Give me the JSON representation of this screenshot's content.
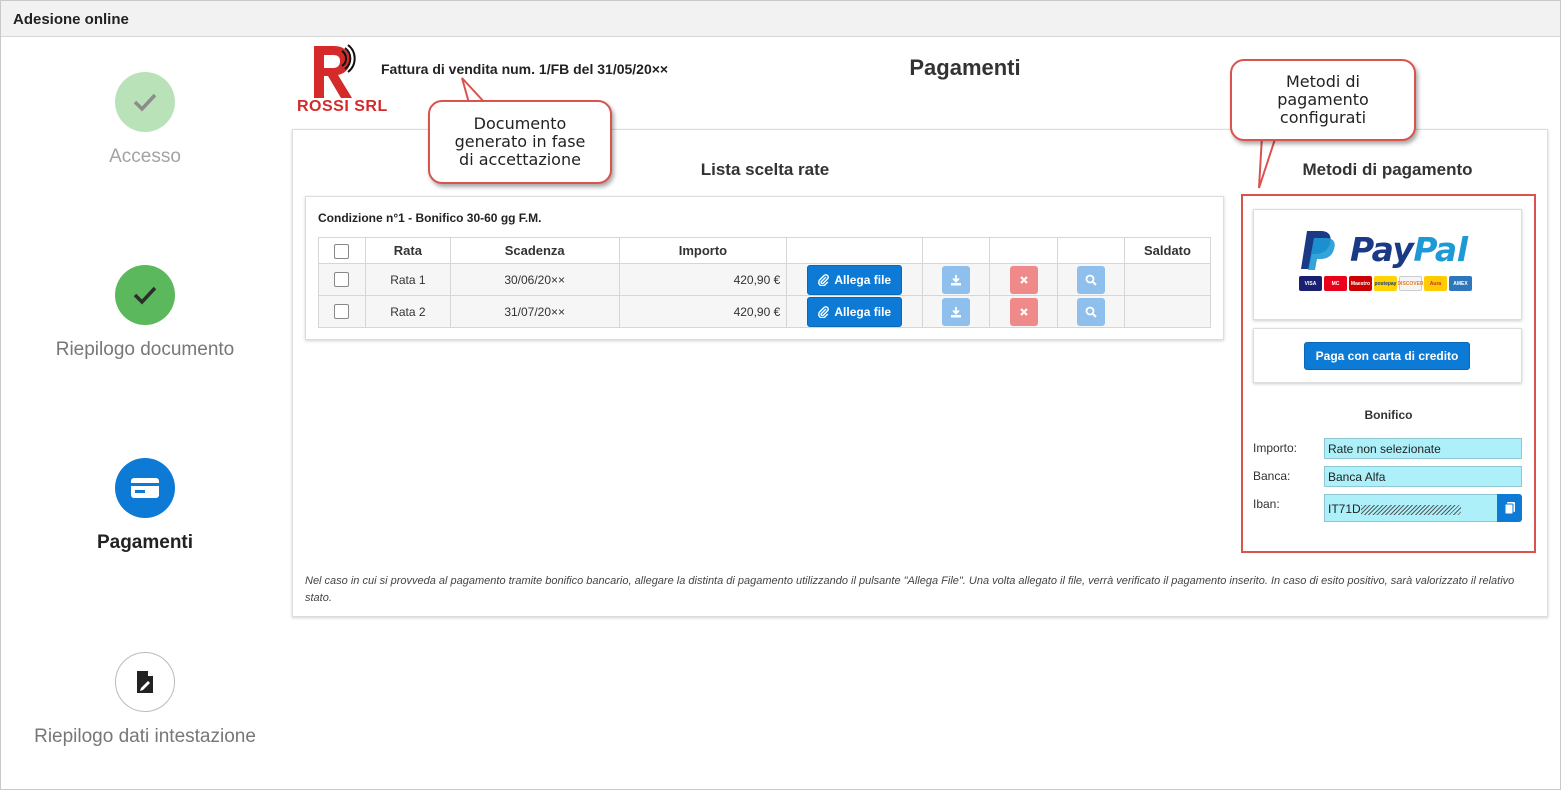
{
  "window": {
    "title": "Adesione online"
  },
  "steps": [
    {
      "label": "Accesso",
      "state": "completed-faded",
      "icon": "check-icon"
    },
    {
      "label": "Riepilogo documento",
      "state": "completed",
      "icon": "check-icon"
    },
    {
      "label": "Pagamenti",
      "state": "active",
      "icon": "credit-card-icon"
    },
    {
      "label": "Riepilogo dati intestazione",
      "state": "pending",
      "icon": "document-edit-icon"
    }
  ],
  "header": {
    "company_name": "ROSSI SRL",
    "invoice_title": "Fattura di vendita num. 1/FB del 31/05/20××",
    "page_title": "Pagamenti"
  },
  "rates_section": {
    "title": "Lista scelta rate",
    "condition": "Condizione n°1 - Bonifico 30-60 gg F.M.",
    "columns": [
      "",
      "Rata",
      "Scadenza",
      "Importo",
      "",
      "",
      "",
      "",
      "Saldato"
    ],
    "rows": [
      {
        "rata": "Rata 1",
        "scadenza": "30/06/20××",
        "importo": "420,90 €",
        "attach_label": "Allega file",
        "saldato": ""
      },
      {
        "rata": "Rata 2",
        "scadenza": "31/07/20××",
        "importo": "420,90 €",
        "attach_label": "Allega file",
        "saldato": ""
      }
    ]
  },
  "payment_methods": {
    "title": "Metodi di pagamento",
    "paypal": {
      "word_pay": "Pay",
      "word_pal": "Pal",
      "cards": [
        "VISA",
        "MC",
        "Maestro",
        "postepay",
        "DISCOVER",
        "Aura",
        "AMEX"
      ]
    },
    "credit_card_button": "Paga con carta di credito",
    "bonifico": {
      "title": "Bonifico",
      "importo_label": "Importo:",
      "importo_value": "Rate non selezionate",
      "banca_label": "Banca:",
      "banca_value": "Banca Alfa",
      "iban_label": "Iban:",
      "iban_value": "IT71D"
    }
  },
  "note": "Nel caso in cui si provveda al pagamento tramite bonifico bancario, allegare la distinta di pagamento utilizzando il pulsante \"Allega File\". Una volta allegato il file, verrà verificato il pagamento inserito. In caso di esito positivo, sarà valorizzato il relativo stato.",
  "callouts": [
    {
      "text_lines": [
        "Documento",
        "generato in fase",
        "di accettazione"
      ]
    },
    {
      "text_lines": [
        "Metodi di",
        "pagamento",
        "configurati"
      ]
    }
  ],
  "colors": {
    "primary": "#0d7ad6",
    "success": "#5cb85c",
    "success_faded": "#b9e2b9",
    "danger": "#d9534f",
    "input_bg": "#adf0fa",
    "brand_red": "#d42a2a"
  }
}
